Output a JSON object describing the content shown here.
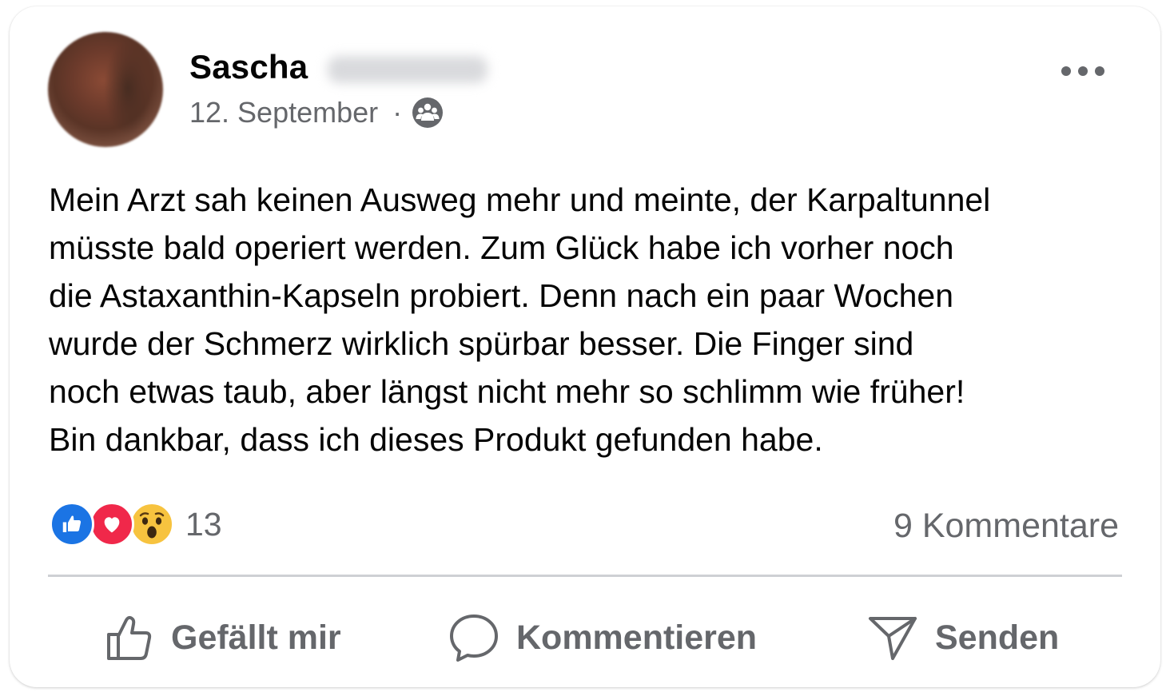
{
  "post": {
    "author_first_name": "Sascha",
    "date": "12. September",
    "separator": "·",
    "audience_icon": "friends-group-icon",
    "more_icon": "more-options-icon",
    "text": "Mein Arzt sah keinen Ausweg mehr und meinte, der Karpaltunnel\nmüsste bald operiert werden. Zum Glück habe ich vorher noch\ndie Astaxanthin-Kapseln probiert. Denn nach ein paar Wochen\nwurde der Schmerz  wirklich spürbar besser. Die Finger sind\nnoch etwas taub, aber längst nicht mehr so schlimm wie früher!\nBin dankbar, dass ich dieses Produkt gefunden habe."
  },
  "stats": {
    "reactions": [
      "like",
      "love",
      "wow"
    ],
    "reaction_count": "13",
    "comments_label": "9 Kommentare"
  },
  "actions": {
    "like_label": "Gefällt mir",
    "comment_label": "Kommentieren",
    "send_label": "Senden"
  },
  "colors": {
    "text": "#050505",
    "secondary": "#65676b",
    "like_blue": "#1b74e4",
    "love_red": "#f0284a",
    "wow_yellow": "#f7c33f",
    "divider": "#ced0d4"
  }
}
